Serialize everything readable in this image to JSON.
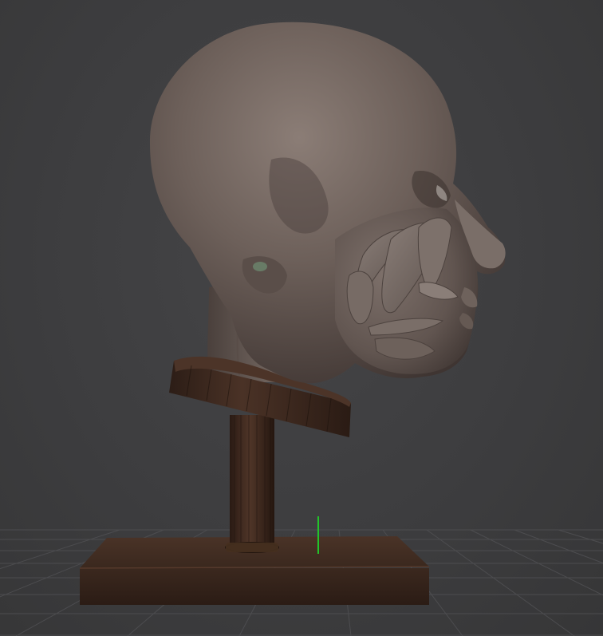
{
  "viewport": {
    "background_color": "#3d3d3f",
    "grid_color": "#4f4f52",
    "axis_indicator_color": "#22c42a"
  },
  "model": {
    "head_color": "#675a54",
    "stand_color": "#3f2a20"
  }
}
